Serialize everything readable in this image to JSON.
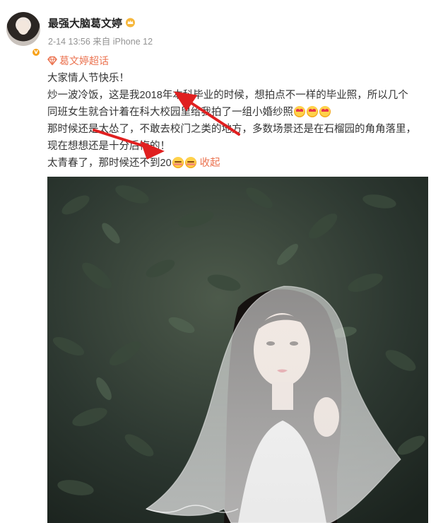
{
  "post": {
    "username": "最强大脑葛文婷",
    "timestamp": "2-14 13:56",
    "source": "来自 iPhone 12",
    "topic": "葛文婷超话",
    "lines": [
      "大家情人节快乐！",
      "炒一波冷饭，这是我2018年本科毕业的时候，想拍点不一样的毕业照，所以几个",
      "同班女生就合计着在科大校园里给我拍了一组小婚纱照",
      "那时候还是太怂了，不敢去校门之类的地方，多数场景还是在石榴园的角角落里，",
      "现在想想还是十分后悔的！",
      "太青春了，那时候还不到20"
    ],
    "collapse_label": "收起"
  },
  "icons": {
    "avatar": "avatar",
    "vip": "vip-badge-icon",
    "crown": "crown-icon",
    "topic": "diamond-icon",
    "emoji_love": "heart-eyes-emoji-icon",
    "emoji_shy": "shy-emoji-icon"
  },
  "colors": {
    "accent": "#eb7350",
    "meta_text": "#939393",
    "annotation_arrow": "#e02020"
  },
  "photo": {
    "subject": "photo-bride-veil"
  }
}
